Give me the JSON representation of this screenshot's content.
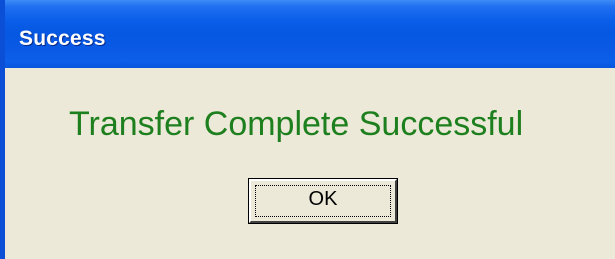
{
  "window": {
    "title": "Success"
  },
  "dialog": {
    "message": "Transfer Complete Successful",
    "message_color": "#1d7f1d",
    "ok_label": "OK"
  },
  "colors": {
    "titlebar": "#0657e2",
    "client_background": "#ece9d8",
    "title_text": "#ffffff"
  }
}
